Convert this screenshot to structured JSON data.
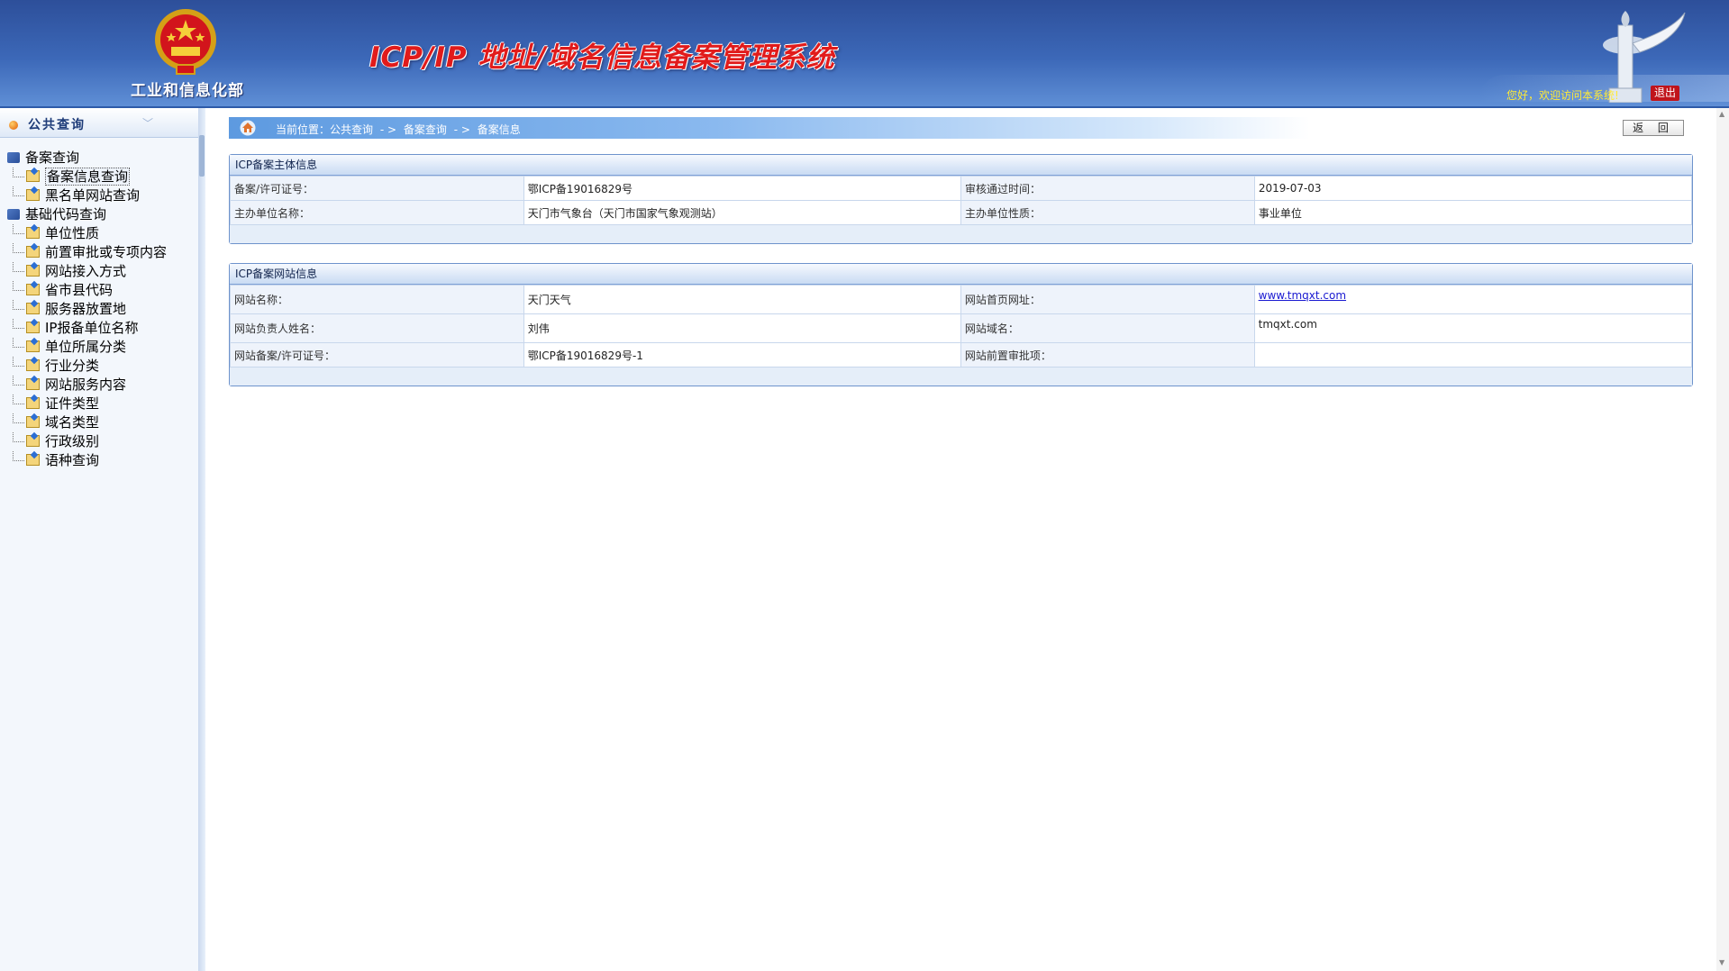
{
  "header": {
    "ministry": "工业和信息化部",
    "title": "ICP/IP 地址/域名信息备案管理系统",
    "welcome": "您好，欢迎访问本系统!",
    "logout": "退出"
  },
  "sidebar": {
    "title": "公共查询",
    "groups": [
      {
        "label": "备案查询",
        "items": [
          "备案信息查询",
          "黑名单网站查询"
        ]
      },
      {
        "label": "基础代码查询",
        "items": [
          "单位性质",
          "前置审批或专项内容",
          "网站接入方式",
          "省市县代码",
          "服务器放置地",
          "IP报备单位名称",
          "单位所属分类",
          "行业分类",
          "网站服务内容",
          "证件类型",
          "域名类型",
          "行政级别",
          "语种查询"
        ]
      }
    ],
    "selected": "备案信息查询"
  },
  "breadcrumb": {
    "prefix": "当前位置：",
    "items": [
      "公共查询",
      "- >",
      "备案查询",
      "- >",
      "备案信息"
    ]
  },
  "back_button": "返 回",
  "entity_panel": {
    "title": "ICP备案主体信息",
    "rows": [
      [
        "备案/许可证号：",
        "鄂ICP备19016829号",
        "审核通过时间：",
        "2019-07-03"
      ],
      [
        "主办单位名称：",
        "天门市气象台（天门市国家气象观测站）",
        "主办单位性质：",
        "事业单位"
      ]
    ]
  },
  "site_panel": {
    "title": "ICP备案网站信息",
    "rows": [
      [
        "网站名称：",
        "天门天气",
        "网站首页网址：",
        "www.tmqxt.com"
      ],
      [
        "网站负责人姓名：",
        "刘伟",
        "网站域名：",
        "tmqxt.com"
      ],
      [
        "网站备案/许可证号：",
        "鄂ICP备19016829号-1",
        "网站前置审批项：",
        ""
      ]
    ]
  },
  "colors": {
    "header_blue": "#3c68b8",
    "title_red": "#e11b1b",
    "welcome_yellow": "#ffea36",
    "logout_red": "#c0141b",
    "link_blue": "#1a1ad1"
  },
  "icons": [
    "national-emblem",
    "pillar-monument",
    "home-icon",
    "folder-icon",
    "group-icon",
    "chevron-down-icon"
  ]
}
